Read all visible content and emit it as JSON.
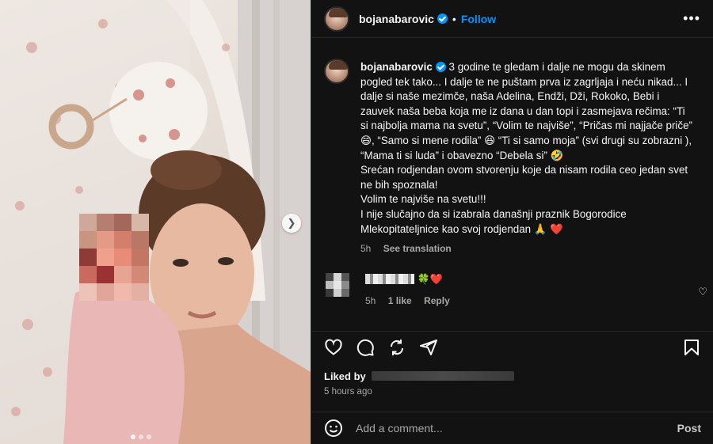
{
  "post": {
    "username": "bojanabarovic",
    "follow_label": "Follow",
    "separator": "•",
    "more_label": "•••",
    "caption_lines": [
      "3 godine te gledam i dalje ne mogu da skinem pogled tek tako... I dalje te ne puštam prva iz zagrljaja i neću nikad... I dalje si naše mezimče, naša Adelina, Endži, Dži, Rokoko, Bebi i zauvek naša beba koja me iz dana u dan topi i zasmejava rečima: “Ti si najbolja mama na svetu”, “Volim te najviše”, “Pričas mi najjače priče” 😄, “Samo si mene rodila” 😆 “Ti si samo moja” (svi drugi su zobrazni ), “Mama ti si luda” i obavezno “Debela si” 🤣",
      "Srećan rodjendan ovom stvorenju koje da nisam rodila ceo jedan svet ne bih spoznala!",
      "Volim te najviše na svetu!!!",
      "I nije slučajno da si izabrala današnji praznik Bogorodice Mlekopitateljnice kao svoj rodjendan 🙏 ❤️"
    ],
    "caption_time": "5h",
    "see_translation": "See translation"
  },
  "comment": {
    "emojis": "🍀❤️",
    "time": "5h",
    "likes": "1 like",
    "reply": "Reply"
  },
  "likes": {
    "label": "Liked by",
    "time_ago": "5 hours ago"
  },
  "composer": {
    "placeholder": "Add a comment...",
    "post_label": "Post"
  },
  "icons": {
    "next": "chevron-right-icon",
    "like": "heart-icon",
    "comment": "comment-icon",
    "repost": "repost-icon",
    "share": "send-icon",
    "save": "bookmark-icon",
    "emoji": "smile-icon"
  },
  "colors": {
    "accent": "#0095f6",
    "background": "#121212",
    "muted": "#a8a8a8",
    "heart_red": "#ed4956"
  }
}
